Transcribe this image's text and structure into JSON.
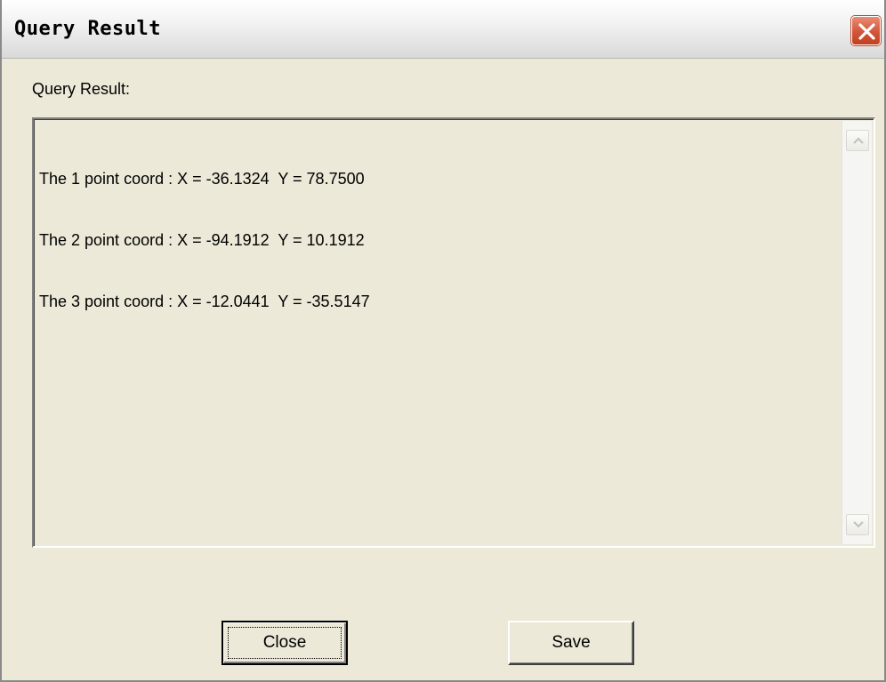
{
  "window": {
    "title": "Query Result"
  },
  "content": {
    "label": "Query Result:",
    "result_lines": [
      "The 1 point coord : X = -36.1324  Y = 78.7500",
      "The 2 point coord : X = -94.1912  Y = 10.1912",
      "The 3 point coord : X = -12.0441  Y = -35.5147"
    ]
  },
  "buttons": {
    "close_label": "Close",
    "save_label": "Save"
  },
  "icons": {
    "title_close": "close-icon",
    "scroll_up": "chevron-up-icon",
    "scroll_down": "chevron-down-icon"
  },
  "colors": {
    "window_bg": "#ece9d8",
    "close_button": "#d2553a"
  }
}
